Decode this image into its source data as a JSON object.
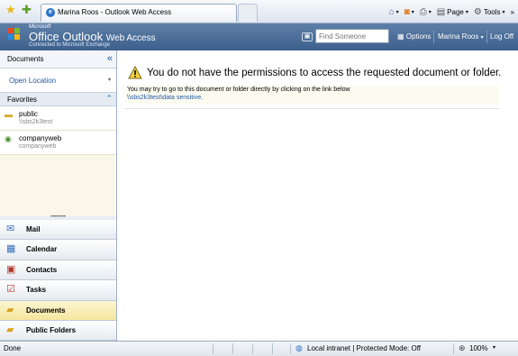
{
  "browser": {
    "tab_title": "Marina Roos - Outlook Web Access",
    "commands": {
      "page_label": "Page",
      "tools_label": "Tools",
      "more_label": "»"
    }
  },
  "owa": {
    "brand": {
      "microsoft": "Microsoft",
      "product": "Office Outlook",
      "product_suffix": "Web Access",
      "tagline": "Connected to Microsoft Exchange"
    },
    "search": {
      "placeholder": "Find Someone"
    },
    "header": {
      "options_label": "Options",
      "user_label": "Marina Roos",
      "logoff_label": "Log Off"
    }
  },
  "left_pane": {
    "title": "Documents",
    "open_location_label": "Open Location",
    "favorites_label": "Favorites",
    "favorites": [
      {
        "name": "public",
        "path": "\\\\sbs2k3test",
        "icon": "folder-icon"
      },
      {
        "name": "companyweb",
        "path": "companyweb",
        "icon": "sharepoint-site-icon"
      }
    ],
    "nav": [
      {
        "label": "Mail",
        "icon": "mail-icon",
        "active": false
      },
      {
        "label": "Calendar",
        "icon": "calendar-icon",
        "active": false
      },
      {
        "label": "Contacts",
        "icon": "contacts-icon",
        "active": false
      },
      {
        "label": "Tasks",
        "icon": "tasks-icon",
        "active": false
      },
      {
        "label": "Documents",
        "icon": "documents-icon",
        "active": true
      },
      {
        "label": "Public Folders",
        "icon": "public-folders-icon",
        "active": false
      }
    ]
  },
  "main": {
    "error_title": "You do not have the permissions to access the requested document or folder.",
    "error_description": "You may try to go to this document or folder directly by clicking on the link below",
    "error_link": "\\\\sbs2k3test\\data sensitive."
  },
  "status_bar": {
    "status": "Done",
    "zone": "Local intranet | Protected Mode: Off",
    "zoom": "100%"
  },
  "colors": {
    "owa_header": "#4a6c97",
    "active_nav": "#f5e69d",
    "link": "#1f57a4"
  }
}
